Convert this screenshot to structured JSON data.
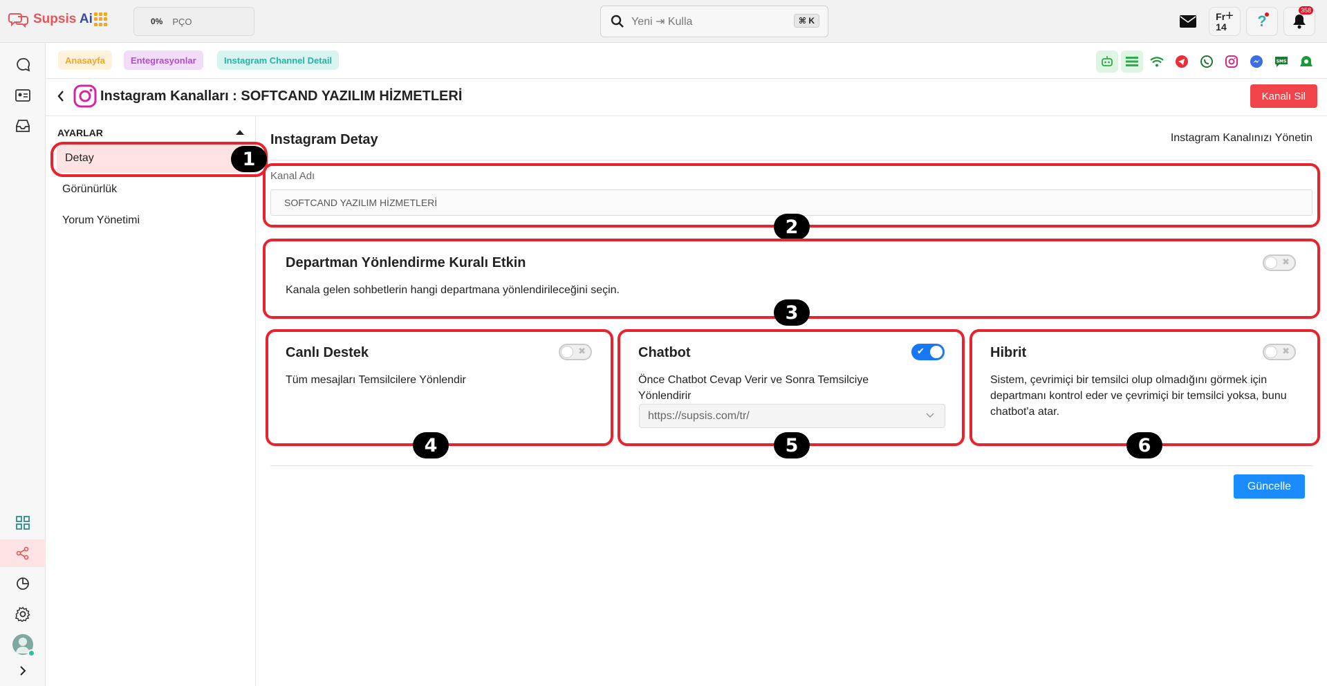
{
  "brand": {
    "name_part1": "Supsis",
    "name_part2": " Ai"
  },
  "topbar": {
    "progress_percent": "0%",
    "progress_code": "PÇO",
    "search_value": "Yeni ⇥ Kulla",
    "search_shortcut": "⌘ K",
    "fr_label": "Fr",
    "fr_number": "14",
    "notification_count": "358"
  },
  "breadcrumb": [
    "Anasayfa",
    "Entegrasyonlar",
    "Instagram Channel Detail"
  ],
  "channels": [
    "bot-icon",
    "list-icon",
    "wifi-icon",
    "telegram-icon",
    "whatsapp-icon",
    "instagram-icon",
    "messenger-icon",
    "sms-icon",
    "webchat-icon"
  ],
  "header": {
    "title": "Instagram Kanalları : SOFTCAND YAZILIM HİZMETLERİ",
    "delete_label": "Kanalı Sil"
  },
  "settings": {
    "heading": "AYARLAR",
    "items": [
      "Detay",
      "Görünürlük",
      "Yorum Yönetimi"
    ],
    "active_index": 0
  },
  "detail": {
    "title": "Instagram Detay",
    "subtitle": "Instagram Kanalınızı Yönetin",
    "channel_name_label": "Kanal Adı",
    "channel_name_value": "SOFTCAND YAZILIM HİZMETLERİ"
  },
  "department_rule": {
    "title": "Departman Yönlendirme Kuralı Etkin",
    "description": "Kanala gelen sohbetlerin hangi departmana yönlendirileceğini seçin.",
    "enabled": false
  },
  "cards": [
    {
      "title": "Canlı Destek",
      "description": "Tüm mesajları Temsilcilere Yönlendir",
      "enabled": false
    },
    {
      "title": "Chatbot",
      "description": "Önce Chatbot Cevap Verir ve Sonra Temsilciye Yönlendirir",
      "enabled": true,
      "select_value": "https://supsis.com/tr/"
    },
    {
      "title": "Hibrit",
      "description": "Sistem, çevrimiçi bir temsilci olup olmadığını görmek için departmanı kontrol eder ve çevrimiçi bir temsilci yoksa, bunu chatbot'a atar.",
      "enabled": false
    }
  ],
  "update_label": "Güncelle",
  "annotations": [
    "1",
    "2",
    "3",
    "4",
    "5",
    "6"
  ],
  "colors": {
    "accent_red": "#f0444a",
    "primary_blue": "#1a8cff",
    "annotation_red": "#e8232b"
  }
}
